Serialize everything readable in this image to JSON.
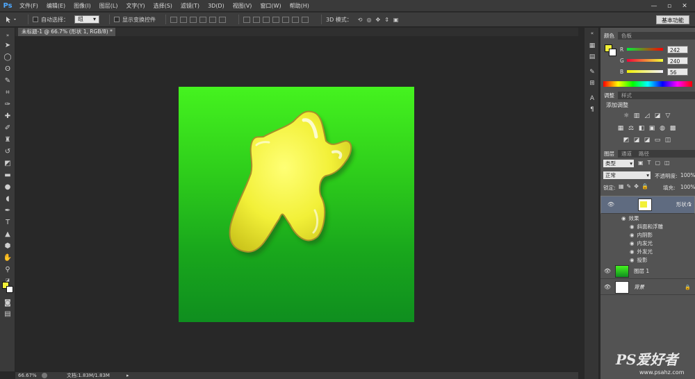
{
  "menubar": {
    "logo": "Ps",
    "items": [
      "文件(F)",
      "编辑(E)",
      "图像(I)",
      "图层(L)",
      "文字(Y)",
      "选择(S)",
      "滤镜(T)",
      "3D(D)",
      "视图(V)",
      "窗口(W)",
      "帮助(H)"
    ],
    "minimize_icon": "minimize-icon",
    "maximize_icon": "maximize-icon",
    "close_icon": "close-icon"
  },
  "options": {
    "auto_select_label": "自动选择：",
    "auto_select_value": "组",
    "show_transform_label": "显示变换控件",
    "mode3d_label": "3D 模式：",
    "workspace_button": "基本功能"
  },
  "document": {
    "tab_title": "未标题-1 @ 66.7% (形状 1, RGB/8) *"
  },
  "status": {
    "zoom": "66.67%",
    "doc_info": "文档:1.83M/1.83M"
  },
  "color_panel": {
    "tabs": [
      "颜色",
      "色板"
    ],
    "r_label": "R",
    "r_value": "242",
    "g_label": "G",
    "g_value": "240",
    "b_label": "B",
    "b_value": "56",
    "foreground": "#f2f038",
    "background": "#ffffff"
  },
  "adjust_panel": {
    "tabs": [
      "调整",
      "样式"
    ],
    "title": "添加调整"
  },
  "layers_panel": {
    "tabs": [
      "图层",
      "通道",
      "路径"
    ],
    "filter_label": "类型",
    "blend_mode": "正常",
    "opacity_label": "不透明度:",
    "opacity_value": "100%",
    "lock_label": "锁定:",
    "fill_label": "填充:",
    "fill_value": "100%",
    "layers": [
      {
        "name": "形状 1",
        "fx": "fx",
        "selected": true
      },
      {
        "name": "图层 1",
        "selected": false
      },
      {
        "name": "背景",
        "selected": false
      }
    ],
    "effects_label": "效果",
    "effects": [
      "斜面和浮雕",
      "内阴影",
      "内发光",
      "外发光",
      "投影"
    ]
  },
  "colors": {
    "canvas_top": "#45f31f",
    "canvas_bottom": "#0f8e1f",
    "blob": "#f2f038",
    "ui_dark": "#3a3a3a",
    "panel": "#535353",
    "selected_layer": "#5f6b80"
  },
  "watermark": {
    "brand": "PS爱好者",
    "url": "www.psahz.com"
  }
}
